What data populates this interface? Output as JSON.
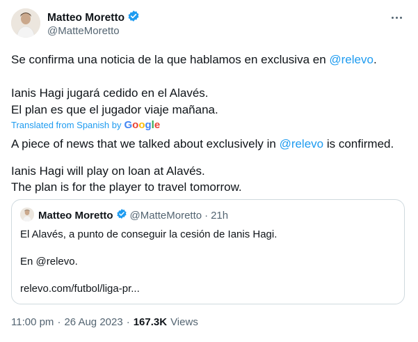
{
  "author": {
    "name": "Matteo Moretto",
    "handle": "@MatteMoretto"
  },
  "tweet": {
    "line1_pre": "Se confirma una noticia de la que hablamos en exclusiva en ",
    "line1_mention": "@relevo",
    "line1_post": ".",
    "line2": "Ianis Hagi jugará cedido en el Alavés.",
    "line3": "El plan es que el jugador viaje mañana."
  },
  "translation": {
    "label": "Translated from Spanish by",
    "provider": "Google",
    "line1_pre": "A piece of news that we talked about exclusively in ",
    "line1_mention": "@relevo",
    "line1_post": " is confirmed.",
    "line2": "Ianis Hagi will play on loan at Alavés.",
    "line3": "The plan is for the player to travel tomorrow."
  },
  "quote": {
    "name": "Matteo Moretto",
    "handle": "@MatteMoretto",
    "separator": "·",
    "time": "21h",
    "line1": "El Alavés, a punto de conseguir la cesión de Ianis Hagi.",
    "line2": "En @relevo.",
    "line3": "relevo.com/futbol/liga-pr..."
  },
  "footer": {
    "time": "11:00 pm",
    "sep1": "·",
    "date": "26 Aug 2023",
    "sep2": "·",
    "views_count": "167.3K",
    "views_label": "Views"
  },
  "colors": {
    "accent": "#1d9bf0",
    "text": "#0f1419",
    "secondary": "#536471",
    "border": "#cfd9de"
  }
}
